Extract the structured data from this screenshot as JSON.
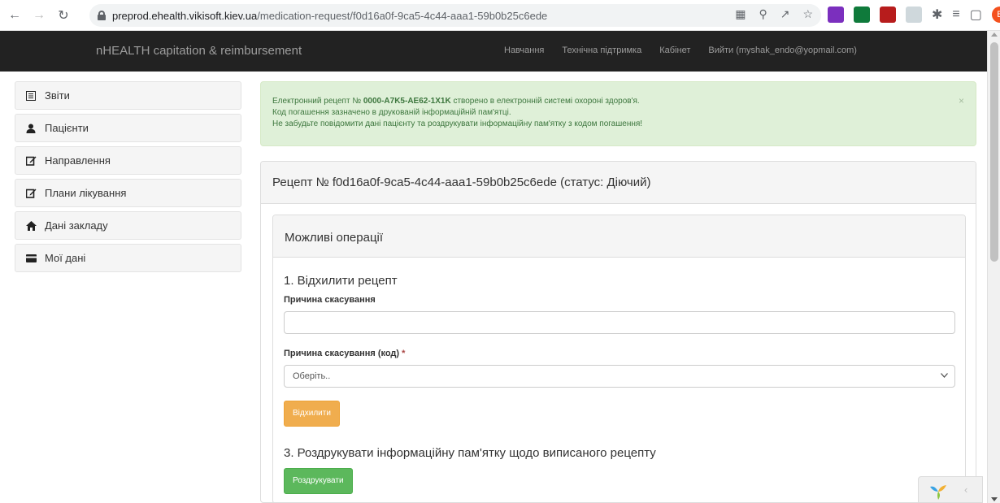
{
  "browser": {
    "url_domain": "preprod.ehealth.vikisoft.kiev.ua",
    "url_path": "/medication-request/f0d16a0f-9ca5-4c44-aaa1-59b0b25c6ede",
    "profile_initial": "B"
  },
  "navbar": {
    "brand": "nHEALTH capitation & reimbursement",
    "links": [
      "Навчання",
      "Технічна підтримка",
      "Кабінет",
      "Вийти (myshak_endo@yopmail.com)"
    ]
  },
  "sidebar": {
    "items": [
      {
        "label": "Звіти",
        "icon": "report-icon"
      },
      {
        "label": "Пацієнти",
        "icon": "user-icon"
      },
      {
        "label": "Направлення",
        "icon": "edit-icon"
      },
      {
        "label": "Плани лікування",
        "icon": "edit-icon"
      },
      {
        "label": "Дані закладу",
        "icon": "home-icon"
      },
      {
        "label": "Мої дані",
        "icon": "card-icon"
      }
    ]
  },
  "alert": {
    "line1_prefix": "Електронний рецепт № ",
    "line1_code": "0000-A7K5-AE62-1X1K",
    "line1_suffix": " створено в електронній системі охороні здоров'я.",
    "line2": "Код погашення зазначено в друкованій інформаційній пам'ятці.",
    "line3": "Не забудьте повідомити дані пацієнту та роздрукувати інформаційну пам'ятку з кодом погашення!",
    "close": "×"
  },
  "panel": {
    "title": "Рецепт № f0d16a0f-9ca5-4c44-aaa1-59b0b25c6ede (статус: Діючий)",
    "operations_title": "Можливі операції",
    "reject": {
      "title": "1. Відхилити рецепт",
      "reason_label": "Причина скасування",
      "reason_value": "",
      "code_label": "Причина скасування (код)",
      "required_mark": "*",
      "code_select_value": "Оберіть..",
      "button": "Відхилити"
    },
    "print": {
      "title": "3. Роздрукувати інформаційну пам'ятку щодо виписаного рецепту",
      "button": "Роздрукувати"
    }
  },
  "colors": {
    "navbar_bg": "#222222",
    "alert_bg": "#dff0d8",
    "alert_text": "#3c763d",
    "warning": "#f0ad4e",
    "success": "#5cb85c"
  }
}
